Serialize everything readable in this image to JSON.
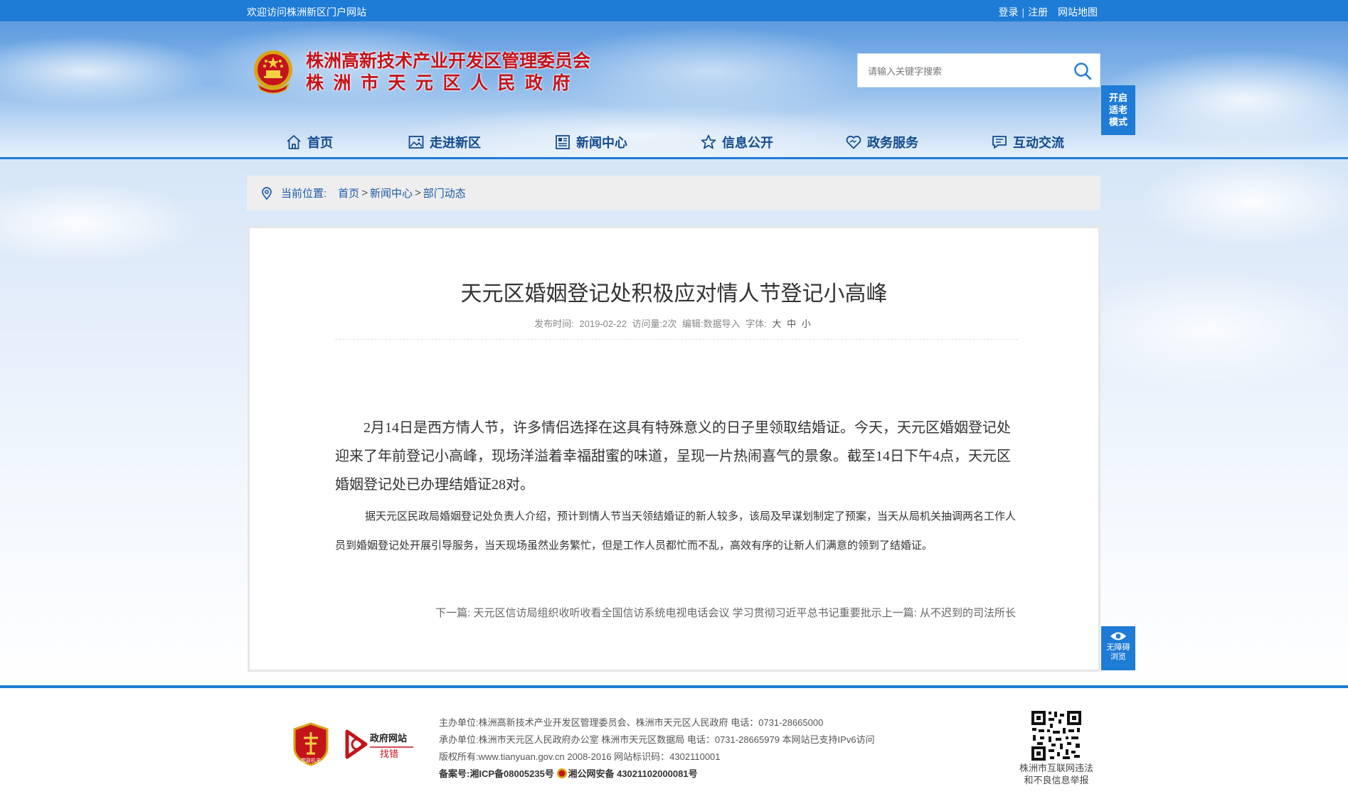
{
  "topbar": {
    "welcome": "欢迎访问株洲新区门户网站",
    "login": "登录",
    "register": "注册",
    "sitemap": "网站地图",
    "separator": "|"
  },
  "header": {
    "title_line1": "株洲高新技术产业开发区管理委员会",
    "title_line2": "株洲市天元区人民政府",
    "search_placeholder": "请输入关键字搜索",
    "elder_mode": [
      "开启",
      "适老",
      "模式"
    ]
  },
  "nav": [
    {
      "label": "首页",
      "icon": "home-icon"
    },
    {
      "label": "走进新区",
      "icon": "picture-icon"
    },
    {
      "label": "新闻中心",
      "icon": "newspaper-icon"
    },
    {
      "label": "信息公开",
      "icon": "star-icon"
    },
    {
      "label": "政务服务",
      "icon": "heart-icon"
    },
    {
      "label": "互动交流",
      "icon": "chat-icon"
    }
  ],
  "breadcrumb": {
    "label": "当前位置:",
    "items": [
      "首页",
      "新闻中心",
      "部门动态"
    ],
    "separator": ">"
  },
  "article": {
    "title": "天元区婚姻登记处积极应对情人节登记小高峰",
    "meta": {
      "publish_label": "发布时间:",
      "publish_date": "2019-02-22",
      "views": "访问量:2次",
      "editor": "编辑:数据导入",
      "font_label": "字体:",
      "font_large": "大",
      "font_medium": "中",
      "font_small": "小"
    },
    "paragraph1": "2月14日是西方情人节，许多情侣选择在这具有特殊意义的日子里领取结婚证。今天，天元区婚姻登记处迎来了年前登记小高峰，现场洋溢着幸福甜蜜的味道，呈现一片热闹喜气的景象。截至14日下午4点，天元区婚姻登记处已办理结婚证28对。",
    "paragraph2": "据天元区民政局婚姻登记处负责人介绍，预计到情人节当天领结婚证的新人较多，该局及早谋划制定了预案，当天从局机关抽调两名工作人员到婚姻登记处开展引导服务，当天现场虽然业务繁忙，但是工作人员都忙而不乱，高效有序的让新人们满意的领到了结婚证。",
    "next_label": "下一篇:",
    "next_title": "天元区信访局组织收听收看全国信访系统电视电话会议 学习贯彻习近平总书记重要批示",
    "prev_label": "上一篇:",
    "prev_title": "从不迟到的司法所长"
  },
  "accessibility": {
    "line1": "无障碍",
    "line2": "浏览"
  },
  "footer": {
    "badge1_text": "党政机关",
    "badge2_line1": "政府网站",
    "badge2_line2": "找错",
    "host_label": "主办单位:",
    "host_value": "株洲高新技术产业开发区管理委员会、株洲市天元区人民政府 电话：0731-28665000",
    "undertake_label": "承办单位:",
    "undertake_value": "株洲市天元区人民政府办公室 株洲市天元区数据局 电话：0731-28665979 本网站已支持IPv6访问",
    "copyright_label": "版权所有:",
    "copyright_value": "www.tianyuan.gov.cn 2008-2016 网站标识码：4302110001",
    "record_label": "备案号:",
    "icp": "湘ICP备08005235号",
    "police": "湘公网安备 43021102000081号",
    "qr_label_line1": "株洲市互联网违法",
    "qr_label_line2": "和不良信息举报"
  },
  "colors": {
    "primary_blue": "#1e7bd6",
    "nav_text": "#134b8e",
    "title_red": "#c4141b"
  }
}
